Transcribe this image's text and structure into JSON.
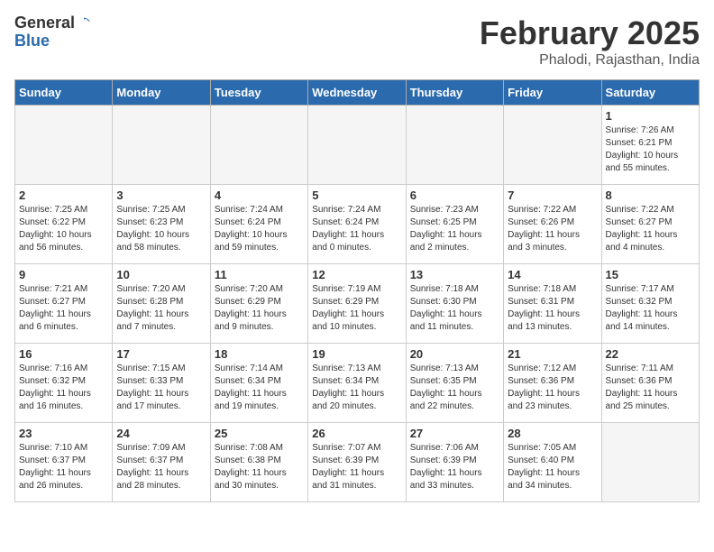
{
  "header": {
    "logo_general": "General",
    "logo_blue": "Blue",
    "month_title": "February 2025",
    "location": "Phalodi, Rajasthan, India"
  },
  "days_of_week": [
    "Sunday",
    "Monday",
    "Tuesday",
    "Wednesday",
    "Thursday",
    "Friday",
    "Saturday"
  ],
  "weeks": [
    [
      {
        "num": "",
        "info": "",
        "empty": true
      },
      {
        "num": "",
        "info": "",
        "empty": true
      },
      {
        "num": "",
        "info": "",
        "empty": true
      },
      {
        "num": "",
        "info": "",
        "empty": true
      },
      {
        "num": "",
        "info": "",
        "empty": true
      },
      {
        "num": "",
        "info": "",
        "empty": true
      },
      {
        "num": "1",
        "info": "Sunrise: 7:26 AM\nSunset: 6:21 PM\nDaylight: 10 hours\nand 55 minutes.",
        "empty": false
      }
    ],
    [
      {
        "num": "2",
        "info": "Sunrise: 7:25 AM\nSunset: 6:22 PM\nDaylight: 10 hours\nand 56 minutes.",
        "empty": false
      },
      {
        "num": "3",
        "info": "Sunrise: 7:25 AM\nSunset: 6:23 PM\nDaylight: 10 hours\nand 58 minutes.",
        "empty": false
      },
      {
        "num": "4",
        "info": "Sunrise: 7:24 AM\nSunset: 6:24 PM\nDaylight: 10 hours\nand 59 minutes.",
        "empty": false
      },
      {
        "num": "5",
        "info": "Sunrise: 7:24 AM\nSunset: 6:24 PM\nDaylight: 11 hours\nand 0 minutes.",
        "empty": false
      },
      {
        "num": "6",
        "info": "Sunrise: 7:23 AM\nSunset: 6:25 PM\nDaylight: 11 hours\nand 2 minutes.",
        "empty": false
      },
      {
        "num": "7",
        "info": "Sunrise: 7:22 AM\nSunset: 6:26 PM\nDaylight: 11 hours\nand 3 minutes.",
        "empty": false
      },
      {
        "num": "8",
        "info": "Sunrise: 7:22 AM\nSunset: 6:27 PM\nDaylight: 11 hours\nand 4 minutes.",
        "empty": false
      }
    ],
    [
      {
        "num": "9",
        "info": "Sunrise: 7:21 AM\nSunset: 6:27 PM\nDaylight: 11 hours\nand 6 minutes.",
        "empty": false
      },
      {
        "num": "10",
        "info": "Sunrise: 7:20 AM\nSunset: 6:28 PM\nDaylight: 11 hours\nand 7 minutes.",
        "empty": false
      },
      {
        "num": "11",
        "info": "Sunrise: 7:20 AM\nSunset: 6:29 PM\nDaylight: 11 hours\nand 9 minutes.",
        "empty": false
      },
      {
        "num": "12",
        "info": "Sunrise: 7:19 AM\nSunset: 6:29 PM\nDaylight: 11 hours\nand 10 minutes.",
        "empty": false
      },
      {
        "num": "13",
        "info": "Sunrise: 7:18 AM\nSunset: 6:30 PM\nDaylight: 11 hours\nand 11 minutes.",
        "empty": false
      },
      {
        "num": "14",
        "info": "Sunrise: 7:18 AM\nSunset: 6:31 PM\nDaylight: 11 hours\nand 13 minutes.",
        "empty": false
      },
      {
        "num": "15",
        "info": "Sunrise: 7:17 AM\nSunset: 6:32 PM\nDaylight: 11 hours\nand 14 minutes.",
        "empty": false
      }
    ],
    [
      {
        "num": "16",
        "info": "Sunrise: 7:16 AM\nSunset: 6:32 PM\nDaylight: 11 hours\nand 16 minutes.",
        "empty": false
      },
      {
        "num": "17",
        "info": "Sunrise: 7:15 AM\nSunset: 6:33 PM\nDaylight: 11 hours\nand 17 minutes.",
        "empty": false
      },
      {
        "num": "18",
        "info": "Sunrise: 7:14 AM\nSunset: 6:34 PM\nDaylight: 11 hours\nand 19 minutes.",
        "empty": false
      },
      {
        "num": "19",
        "info": "Sunrise: 7:13 AM\nSunset: 6:34 PM\nDaylight: 11 hours\nand 20 minutes.",
        "empty": false
      },
      {
        "num": "20",
        "info": "Sunrise: 7:13 AM\nSunset: 6:35 PM\nDaylight: 11 hours\nand 22 minutes.",
        "empty": false
      },
      {
        "num": "21",
        "info": "Sunrise: 7:12 AM\nSunset: 6:36 PM\nDaylight: 11 hours\nand 23 minutes.",
        "empty": false
      },
      {
        "num": "22",
        "info": "Sunrise: 7:11 AM\nSunset: 6:36 PM\nDaylight: 11 hours\nand 25 minutes.",
        "empty": false
      }
    ],
    [
      {
        "num": "23",
        "info": "Sunrise: 7:10 AM\nSunset: 6:37 PM\nDaylight: 11 hours\nand 26 minutes.",
        "empty": false
      },
      {
        "num": "24",
        "info": "Sunrise: 7:09 AM\nSunset: 6:37 PM\nDaylight: 11 hours\nand 28 minutes.",
        "empty": false
      },
      {
        "num": "25",
        "info": "Sunrise: 7:08 AM\nSunset: 6:38 PM\nDaylight: 11 hours\nand 30 minutes.",
        "empty": false
      },
      {
        "num": "26",
        "info": "Sunrise: 7:07 AM\nSunset: 6:39 PM\nDaylight: 11 hours\nand 31 minutes.",
        "empty": false
      },
      {
        "num": "27",
        "info": "Sunrise: 7:06 AM\nSunset: 6:39 PM\nDaylight: 11 hours\nand 33 minutes.",
        "empty": false
      },
      {
        "num": "28",
        "info": "Sunrise: 7:05 AM\nSunset: 6:40 PM\nDaylight: 11 hours\nand 34 minutes.",
        "empty": false
      },
      {
        "num": "",
        "info": "",
        "empty": true
      }
    ]
  ]
}
